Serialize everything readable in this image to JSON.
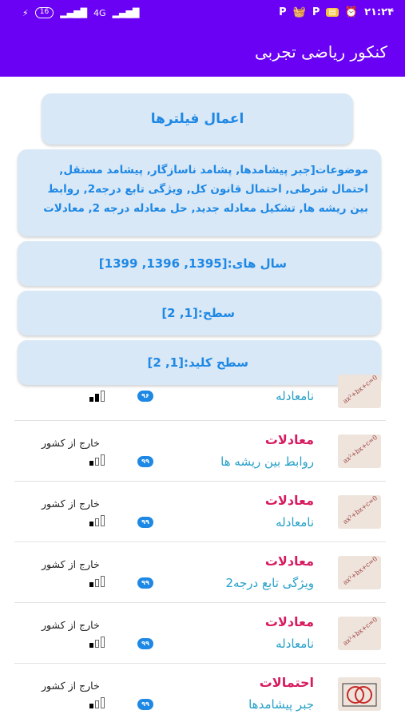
{
  "status_bar": {
    "time": "۲۱:۲۴",
    "battery": "16",
    "network": "4G"
  },
  "app_bar": {
    "title": "کنکور ریاضی تجربی"
  },
  "filters": {
    "apply_label": "اعمال فیلترها",
    "topics": "موضوعات[جبر پیشامدها, پشامد ناسازگار, پیشامد مستقل, احتمال شرطی, احتمال قانون کل, ویژگی تابع درجه2, روابط بین ریشه ها, تشکیل معادله جدید, حل معادله درجه 2, معادلات",
    "years": "سال های:[1395, 1396, 1399]",
    "level": "سطح:[1, 2]",
    "key_level": "سطح کلید:[1, 2]"
  },
  "questions": [
    {
      "category": "",
      "subtopic": "نامعادله",
      "year_badge": "۹۶",
      "location": "",
      "difficulty": 2,
      "thumb": "formula"
    },
    {
      "category": "معادلات",
      "subtopic": "روابط بین ریشه ها",
      "year_badge": "۹۹",
      "location": "خارج از کشور",
      "difficulty": 1,
      "thumb": "formula"
    },
    {
      "category": "معادلات",
      "subtopic": "نامعادله",
      "year_badge": "۹۹",
      "location": "خارج از کشور",
      "difficulty": 1,
      "thumb": "formula"
    },
    {
      "category": "معادلات",
      "subtopic": "ویژگی تابع درجه2",
      "year_badge": "۹۹",
      "location": "خارج از کشور",
      "difficulty": 1,
      "thumb": "formula"
    },
    {
      "category": "معادلات",
      "subtopic": "نامعادله",
      "year_badge": "۹۹",
      "location": "خارج از کشور",
      "difficulty": 1,
      "thumb": "formula"
    },
    {
      "category": "احتمالات",
      "subtopic": "جبر پیشامدها",
      "year_badge": "۹۹",
      "location": "خارج از کشور",
      "difficulty": 1,
      "thumb": "venn"
    }
  ],
  "thumb_formula_text": "ax²+bx+c=0",
  "colors": {
    "primary": "#6a00f4",
    "card_bg": "#d9e8f6",
    "filter_text": "#1e88e5",
    "category": "#d81b60",
    "subtopic": "#26a0c8"
  }
}
